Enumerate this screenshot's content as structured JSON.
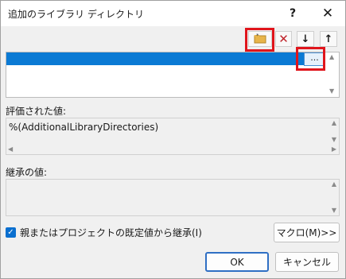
{
  "window": {
    "title": "追加のライブラリ ディレクトリ",
    "help_label": "?",
    "close_label": "✕"
  },
  "toolbar": {
    "new_folder_icon": "new-folder-icon",
    "delete_icon": "delete-x-icon",
    "down_icon": "arrow-down-icon",
    "up_icon": "arrow-up-icon",
    "down_glyph": "↓",
    "up_glyph": "↑",
    "delete_glyph": "✕"
  },
  "list": {
    "browse_label": "..."
  },
  "evaluated": {
    "label": "評価された値:",
    "value": "%(AdditionalLibraryDirectories)"
  },
  "inherited": {
    "label": "継承の値:"
  },
  "inherit_checkbox": {
    "label": "親またはプロジェクトの既定値から継承(I)",
    "checked": true
  },
  "buttons": {
    "macro": "マクロ(M)>>",
    "ok": "OK",
    "cancel": "キャンセル"
  },
  "colors": {
    "accent": "#0b7ad4",
    "highlight": "#e0151c"
  }
}
